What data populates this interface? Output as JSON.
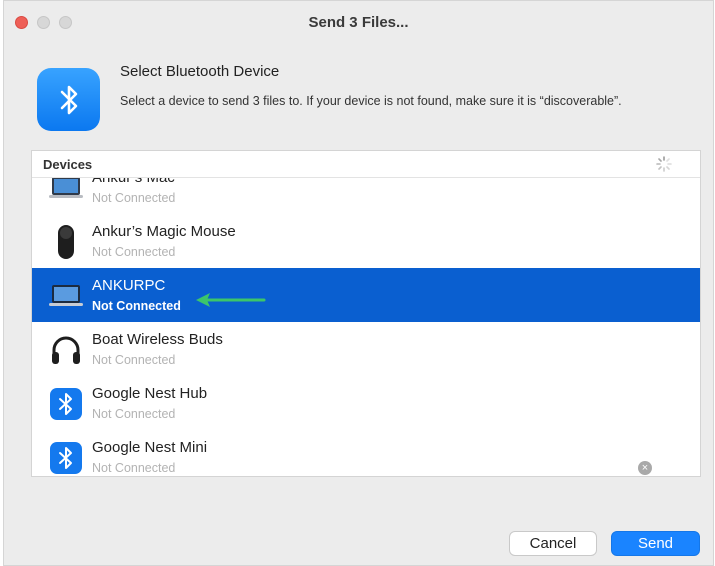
{
  "window": {
    "title": "Send 3 Files..."
  },
  "header": {
    "icon": "bluetooth-icon",
    "title": "Select Bluetooth Device",
    "description": "Select a device to send 3 files to. If your device is not found, make sure it is “discoverable”."
  },
  "devices": {
    "header_label": "Devices",
    "items": [
      {
        "name": "Ankur’s Mac",
        "status": "Not Connected",
        "icon": "laptop-icon",
        "selected": false
      },
      {
        "name": "Ankur’s Magic Mouse",
        "status": "Not Connected",
        "icon": "mouse-icon",
        "selected": false
      },
      {
        "name": "ANKURPC",
        "status": "Not Connected",
        "icon": "laptop-icon",
        "selected": true
      },
      {
        "name": "Boat Wireless Buds",
        "status": "Not Connected",
        "icon": "headphones-icon",
        "selected": false
      },
      {
        "name": "Google Nest Hub",
        "status": "Not Connected",
        "icon": "bluetooth-icon",
        "selected": false
      },
      {
        "name": "Google Nest Mini",
        "status": "Not Connected",
        "icon": "bluetooth-icon",
        "selected": false
      }
    ]
  },
  "footer": {
    "cancel_label": "Cancel",
    "send_label": "Send"
  },
  "colors": {
    "selection": "#0a5fd0",
    "accent": "#1a84ff",
    "arrow": "#3cc66a"
  }
}
